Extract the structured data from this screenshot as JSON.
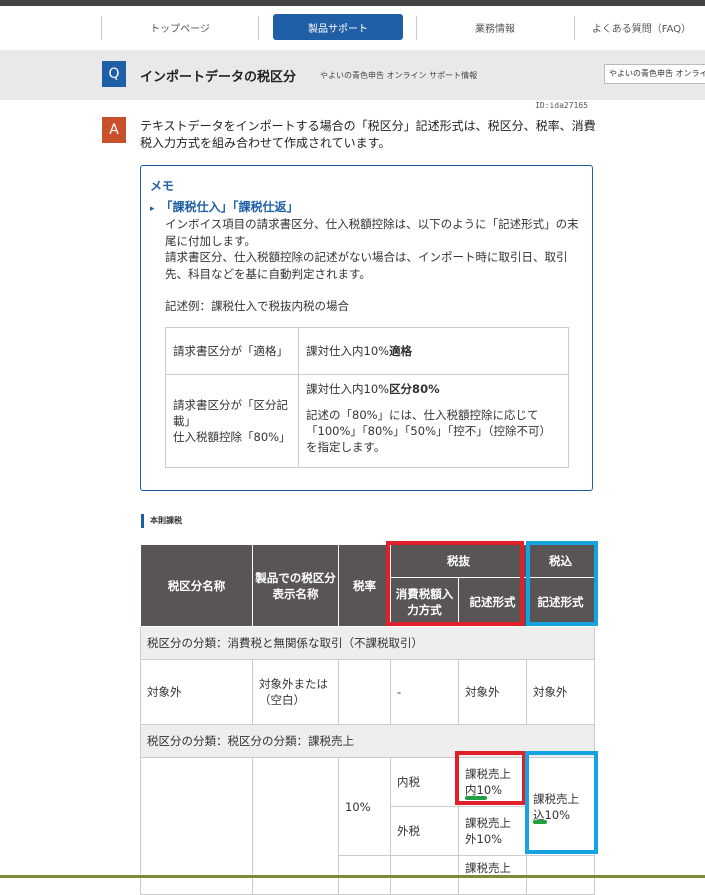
{
  "nav": {
    "items": [
      "トップページ",
      "製品サポート",
      "業務情報",
      "よくある質問（FAQ）"
    ]
  },
  "question": {
    "icon": "Q",
    "title": "インポートデータの税区分",
    "subtitle": "やよいの青色申告 オンライン サポート情報",
    "search_value": "やよいの青色申告 オンライン"
  },
  "doc_id": "ID:ida27165",
  "answer": {
    "icon": "A",
    "text": "テキストデータをインポートする場合の「税区分」記述形式は、税区分、税率、消費税入力方式を組み合わせて作成されています。"
  },
  "memo": {
    "title": "メモ",
    "heading": "「課税仕入」「課税仕返」",
    "body": [
      "インボイス項目の請求書区分、仕入税額控除は、以下のように「記述形式」の末尾に付加します。",
      "請求書区分、仕入税額控除の記述がない場合は、インポート時に取引日、取引先、科目などを基に自動判定されます。"
    ],
    "example": "記述例：課税仕入で税抜内税の場合",
    "rows": [
      {
        "label": "請求書区分が「適格」",
        "value": "課対仕入内10%",
        "value_bold": "適格",
        "note": ""
      },
      {
        "label": "請求書区分が「区分記載」\n仕入税額控除「80%」",
        "value": "課対仕入内10%",
        "value_bold": "区分80%",
        "note": "記述の「80%」には、仕入税額控除に応じて「100%」「80%」「50%」「控不」（控除不可）を指定します。"
      }
    ]
  },
  "section": "本則課税",
  "table": {
    "headers": {
      "name": "税区分名称",
      "product": "製品での税区分表示名称",
      "rate": "税率",
      "zeinuki": "税抜",
      "zeikomi": "税込",
      "input_method": "消費税額入力方式",
      "format": "記述形式",
      "format2": "記述形式"
    },
    "cat1": "税区分の分類：消費税と無関係な取引（不課税取引）",
    "row1": {
      "name": "対象外",
      "product": "対象外または（空白）",
      "rate": "",
      "method": "-",
      "format": "対象外",
      "format_incl": "対象外"
    },
    "cat2": "税区分の分類：税区分の分類：課税売上",
    "row2": {
      "rate": "10%",
      "method_a": "内税",
      "format_a": "課税売上内10%",
      "method_b": "外税",
      "format_b": "課税売上外10%",
      "format_incl": "課税売上込10%",
      "format_c": "課税売上"
    }
  }
}
